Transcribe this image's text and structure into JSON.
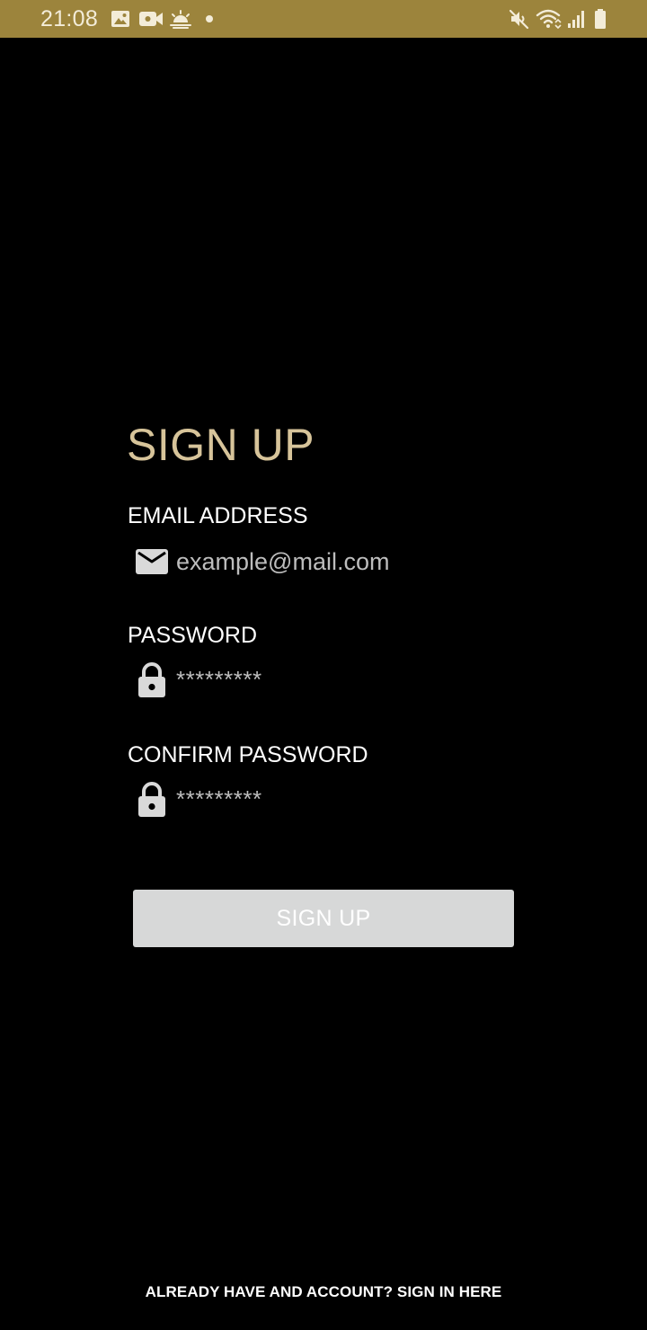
{
  "status_bar": {
    "time": "21:08",
    "background": "#9c843c",
    "left_icons": [
      "image-icon",
      "video-camera-icon",
      "weather-icon",
      "notification-dot-icon"
    ],
    "right_icons": [
      "mute-icon",
      "wifi-icon",
      "cellular-signal-icon",
      "battery-icon"
    ]
  },
  "form": {
    "title": "SIGN UP",
    "title_color": "#d7c49a",
    "email": {
      "label": "EMAIL ADDRESS",
      "icon": "mail-icon",
      "placeholder": "example@mail.com"
    },
    "password": {
      "label": "PASSWORD",
      "icon": "lock-icon",
      "value": "*********"
    },
    "confirm_password": {
      "label": "CONFIRM PASSWORD",
      "icon": "lock-icon",
      "value": "*********"
    },
    "submit": {
      "label": "SIGN UP",
      "background": "#d7d8d8"
    }
  },
  "footer": {
    "signin_link": "ALREADY HAVE AND ACCOUNT? SIGN IN HERE"
  }
}
